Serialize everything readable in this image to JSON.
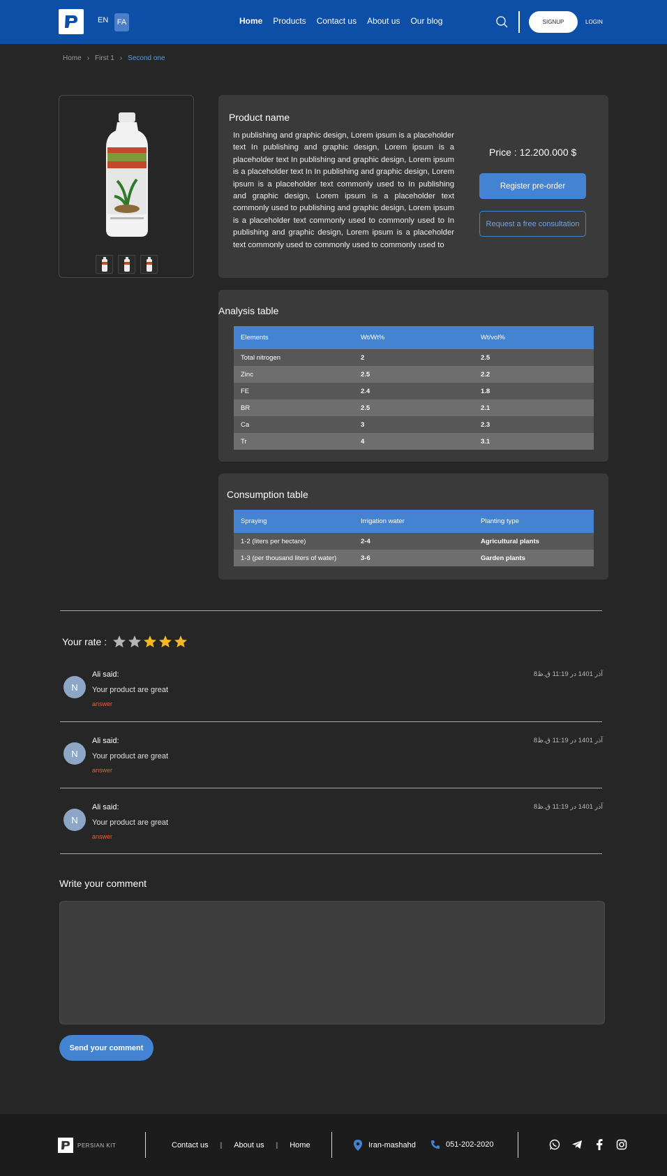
{
  "header": {
    "lang_en": "EN",
    "lang_fa": "FA",
    "nav": [
      "Home",
      "Products",
      "Contact us",
      "About us",
      "Our blog"
    ],
    "signup": "SIGNUP",
    "login": "LOGIN"
  },
  "breadcrumb": [
    "Home",
    "First 1",
    "Second one"
  ],
  "product": {
    "title": "Product name",
    "description": "In publishing and graphic design, Lorem ipsum is a placeholder text  In publishing and graphic design, Lorem ipsum is a placeholder text  In publishing and graphic design, Lorem ipsum is a placeholder text  In In publishing and graphic design, Lorem ipsum is a placeholder text commonly used to In publishing and graphic design, Lorem ipsum is a placeholder text commonly used to publishing and graphic design, Lorem ipsum is a placeholder text commonly used to commonly used to In publishing and graphic design, Lorem ipsum is a placeholder text commonly used to commonly used to commonly used to",
    "price": "Price : 12.200.000 $",
    "preorder_label": "Register pre-order",
    "consult_label": "Request a free consultation"
  },
  "analysis": {
    "title": "Analysis table",
    "headers": [
      "Elements",
      "Wt/Wt%",
      "Wt/vol%"
    ],
    "rows": [
      [
        "Total nitrogen",
        "2",
        "2.5"
      ],
      [
        "Zinc",
        "2.5",
        "2.2"
      ],
      [
        "FE",
        "2.4",
        "1.8"
      ],
      [
        "BR",
        "2.5",
        "2.1"
      ],
      [
        "Ca",
        "3",
        "2.3"
      ],
      [
        "Tr",
        "4",
        "3.1"
      ]
    ]
  },
  "consumption": {
    "title": "Consumption table",
    "headers": [
      "Spraying",
      "Irrigation water",
      "Planting type"
    ],
    "rows": [
      [
        "1-2 (liters per hectare)",
        "2-4",
        "Agricultural plants"
      ],
      [
        "1-3 (per thousand liters of water)",
        "3-6",
        "Garden plants"
      ]
    ]
  },
  "rating": {
    "label": "Your rate :",
    "stars_total": 5,
    "stars_filled": 3,
    "star_gold": "#f5b820",
    "star_gray": "#b5b5b5"
  },
  "comments": [
    {
      "initial": "N",
      "author": "Ali said:",
      "text": "Your product are great",
      "answer": "answer",
      "date": "8آذر 1401 در 11:19 ق.ظ"
    },
    {
      "initial": "N",
      "author": "Ali said:",
      "text": "Your product are great",
      "answer": "answer",
      "date": "8آذر 1401 در 11:19 ق.ظ"
    },
    {
      "initial": "N",
      "author": "Ali said:",
      "text": "Your product are great",
      "answer": "answer",
      "date": "8آذر 1401 در 11:19 ق.ظ"
    }
  ],
  "write_comment": {
    "title": "Write your comment",
    "send_label": "Send your comment"
  },
  "footer": {
    "brand": "PERSIAN KIT",
    "links": [
      "Contact us",
      "About us",
      "Home"
    ],
    "separator": "|",
    "location": "Iran-mashahd",
    "phone": "051-202-2020",
    "social": [
      "whatsapp-icon",
      "telegram-icon",
      "facebook-icon",
      "instagram-icon"
    ]
  },
  "colors": {
    "header_bg": "#0d4ea6",
    "accent": "#4483d1",
    "page_bg": "#262626",
    "card_bg": "#3a3a3a",
    "answer": "#e0623a"
  }
}
